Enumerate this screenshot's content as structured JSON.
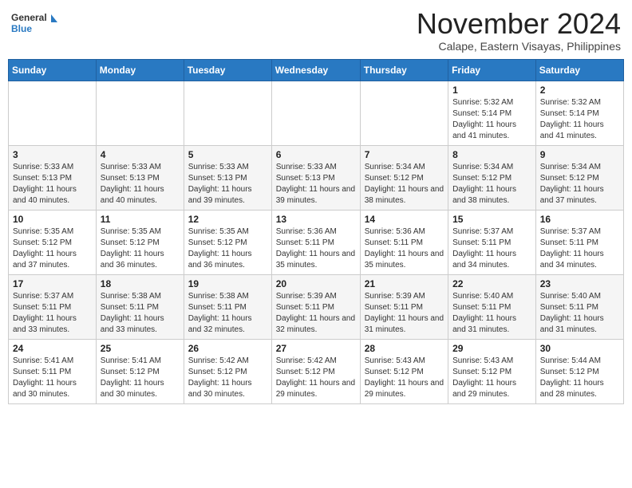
{
  "header": {
    "logo_line1": "General",
    "logo_line2": "Blue",
    "month": "November 2024",
    "location": "Calape, Eastern Visayas, Philippines"
  },
  "weekdays": [
    "Sunday",
    "Monday",
    "Tuesday",
    "Wednesday",
    "Thursday",
    "Friday",
    "Saturday"
  ],
  "weeks": [
    [
      {
        "day": "",
        "info": ""
      },
      {
        "day": "",
        "info": ""
      },
      {
        "day": "",
        "info": ""
      },
      {
        "day": "",
        "info": ""
      },
      {
        "day": "",
        "info": ""
      },
      {
        "day": "1",
        "info": "Sunrise: 5:32 AM\nSunset: 5:14 PM\nDaylight: 11 hours and 41 minutes."
      },
      {
        "day": "2",
        "info": "Sunrise: 5:32 AM\nSunset: 5:14 PM\nDaylight: 11 hours and 41 minutes."
      }
    ],
    [
      {
        "day": "3",
        "info": "Sunrise: 5:33 AM\nSunset: 5:13 PM\nDaylight: 11 hours and 40 minutes."
      },
      {
        "day": "4",
        "info": "Sunrise: 5:33 AM\nSunset: 5:13 PM\nDaylight: 11 hours and 40 minutes."
      },
      {
        "day": "5",
        "info": "Sunrise: 5:33 AM\nSunset: 5:13 PM\nDaylight: 11 hours and 39 minutes."
      },
      {
        "day": "6",
        "info": "Sunrise: 5:33 AM\nSunset: 5:13 PM\nDaylight: 11 hours and 39 minutes."
      },
      {
        "day": "7",
        "info": "Sunrise: 5:34 AM\nSunset: 5:12 PM\nDaylight: 11 hours and 38 minutes."
      },
      {
        "day": "8",
        "info": "Sunrise: 5:34 AM\nSunset: 5:12 PM\nDaylight: 11 hours and 38 minutes."
      },
      {
        "day": "9",
        "info": "Sunrise: 5:34 AM\nSunset: 5:12 PM\nDaylight: 11 hours and 37 minutes."
      }
    ],
    [
      {
        "day": "10",
        "info": "Sunrise: 5:35 AM\nSunset: 5:12 PM\nDaylight: 11 hours and 37 minutes."
      },
      {
        "day": "11",
        "info": "Sunrise: 5:35 AM\nSunset: 5:12 PM\nDaylight: 11 hours and 36 minutes."
      },
      {
        "day": "12",
        "info": "Sunrise: 5:35 AM\nSunset: 5:12 PM\nDaylight: 11 hours and 36 minutes."
      },
      {
        "day": "13",
        "info": "Sunrise: 5:36 AM\nSunset: 5:11 PM\nDaylight: 11 hours and 35 minutes."
      },
      {
        "day": "14",
        "info": "Sunrise: 5:36 AM\nSunset: 5:11 PM\nDaylight: 11 hours and 35 minutes."
      },
      {
        "day": "15",
        "info": "Sunrise: 5:37 AM\nSunset: 5:11 PM\nDaylight: 11 hours and 34 minutes."
      },
      {
        "day": "16",
        "info": "Sunrise: 5:37 AM\nSunset: 5:11 PM\nDaylight: 11 hours and 34 minutes."
      }
    ],
    [
      {
        "day": "17",
        "info": "Sunrise: 5:37 AM\nSunset: 5:11 PM\nDaylight: 11 hours and 33 minutes."
      },
      {
        "day": "18",
        "info": "Sunrise: 5:38 AM\nSunset: 5:11 PM\nDaylight: 11 hours and 33 minutes."
      },
      {
        "day": "19",
        "info": "Sunrise: 5:38 AM\nSunset: 5:11 PM\nDaylight: 11 hours and 32 minutes."
      },
      {
        "day": "20",
        "info": "Sunrise: 5:39 AM\nSunset: 5:11 PM\nDaylight: 11 hours and 32 minutes."
      },
      {
        "day": "21",
        "info": "Sunrise: 5:39 AM\nSunset: 5:11 PM\nDaylight: 11 hours and 31 minutes."
      },
      {
        "day": "22",
        "info": "Sunrise: 5:40 AM\nSunset: 5:11 PM\nDaylight: 11 hours and 31 minutes."
      },
      {
        "day": "23",
        "info": "Sunrise: 5:40 AM\nSunset: 5:11 PM\nDaylight: 11 hours and 31 minutes."
      }
    ],
    [
      {
        "day": "24",
        "info": "Sunrise: 5:41 AM\nSunset: 5:11 PM\nDaylight: 11 hours and 30 minutes."
      },
      {
        "day": "25",
        "info": "Sunrise: 5:41 AM\nSunset: 5:12 PM\nDaylight: 11 hours and 30 minutes."
      },
      {
        "day": "26",
        "info": "Sunrise: 5:42 AM\nSunset: 5:12 PM\nDaylight: 11 hours and 30 minutes."
      },
      {
        "day": "27",
        "info": "Sunrise: 5:42 AM\nSunset: 5:12 PM\nDaylight: 11 hours and 29 minutes."
      },
      {
        "day": "28",
        "info": "Sunrise: 5:43 AM\nSunset: 5:12 PM\nDaylight: 11 hours and 29 minutes."
      },
      {
        "day": "29",
        "info": "Sunrise: 5:43 AM\nSunset: 5:12 PM\nDaylight: 11 hours and 29 minutes."
      },
      {
        "day": "30",
        "info": "Sunrise: 5:44 AM\nSunset: 5:12 PM\nDaylight: 11 hours and 28 minutes."
      }
    ]
  ]
}
